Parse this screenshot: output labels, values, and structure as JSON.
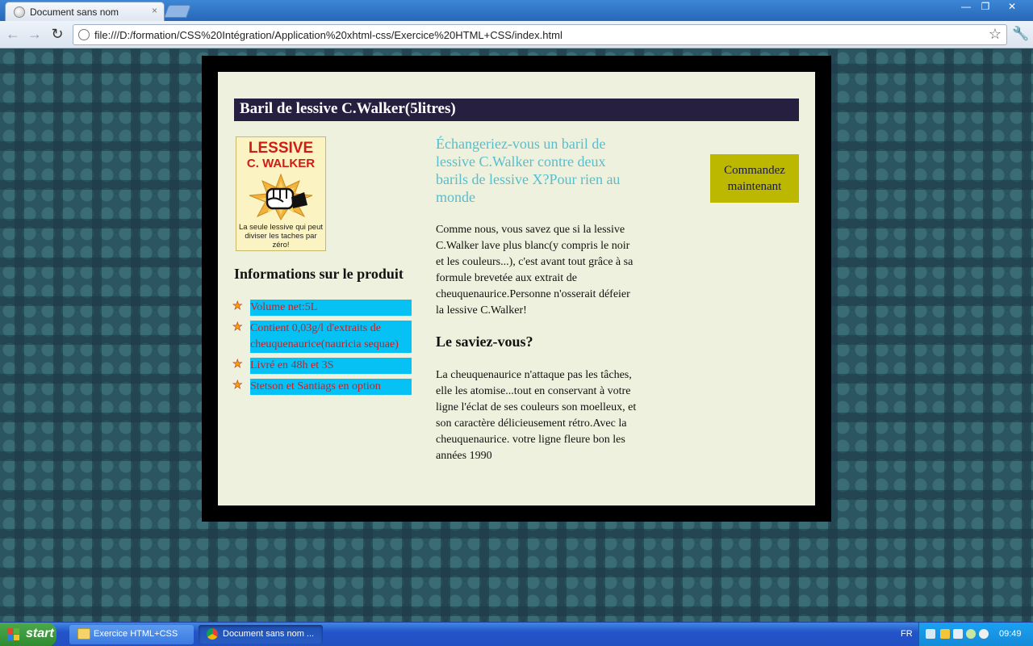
{
  "browser": {
    "tab_title": "Document sans nom",
    "url": "file:///D:/formation/CSS%20Intégration/Application%20xhtml-css/Exercice%20HTML+CSS/index.html",
    "controls": {
      "close_tab": "×",
      "minimize": "—",
      "restore": "❐",
      "close_window": "✕"
    }
  },
  "page": {
    "title": "Baril de lessive C.Walker(5litres)",
    "pack": {
      "brand_line1": "LESSIVE",
      "brand_line2": "C. WALKER",
      "tagline": "La seule lessive qui peut diviser les taches par zéro!"
    },
    "info_heading": "Informations sur le produit",
    "features": [
      "Volume net:5L",
      "Contient 0,03g/l d'extraits de cheuquenaurice(nauricia sequae)",
      "Livré en 48h et 3S",
      "Stetson et Santiags en option"
    ],
    "lead": "Échangeriez-vous un baril de lessive C.Walker contre deux barils de lessive X?Pour rien au monde",
    "body1": "Comme nous, vous savez que si la lessive C.Walker lave plus blanc(y compris le noir et les couleurs...), c'est avant tout grâce à sa formule brevetée aux extrait de cheuquenaurice.Personne n'osserait défeier la lessive C.Walker!",
    "saviez_heading": "Le saviez-vous?",
    "body2": "La cheuquenaurice n'attaque pas les tâches, elle les atomise...tout en conservant à votre ligne l'éclat de ses couleurs son moelleux, et son caractère délicieusement rétro.Avec la cheuquenaurice. votre ligne fleure bon les années 1990",
    "order_button": "Commandez maintenant"
  },
  "taskbar": {
    "start_label": "start",
    "tasks": [
      "Exercice HTML+CSS",
      "Document sans nom ..."
    ],
    "language": "FR",
    "clock": "09:49"
  },
  "colors": {
    "title_bar": "#271f3f",
    "content_bg": "#eef1dd",
    "feature_bg": "#06c2f4",
    "feature_text": "#d21c1c",
    "lead_text": "#58bdcc",
    "order_button": "#bcb800"
  }
}
